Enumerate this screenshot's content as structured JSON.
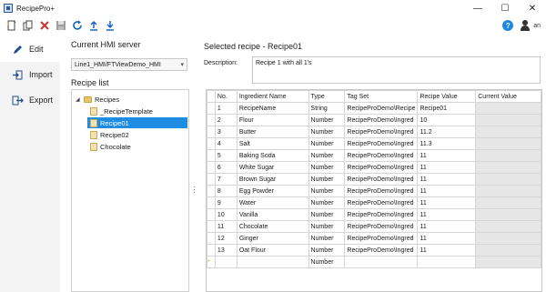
{
  "app": {
    "title": "RecipePro+"
  },
  "window_controls": {
    "minimize": "—",
    "maximize": "☐",
    "close": "✕"
  },
  "toolbar": {
    "buttons": [
      "new-icon",
      "duplicate-icon",
      "delete-icon",
      "save-icon",
      "refresh-icon",
      "upload-icon",
      "download-icon"
    ],
    "user_label": "an"
  },
  "nav": {
    "items": [
      {
        "label": "Edit",
        "icon": "pencil-icon"
      },
      {
        "label": "Import",
        "icon": "import-icon"
      },
      {
        "label": "Export",
        "icon": "export-icon"
      }
    ]
  },
  "server": {
    "title": "Current HMI server",
    "value": "Line1_HMI/FTViewDemo_HMI"
  },
  "recipe_list": {
    "title": "Recipe list",
    "root": "Recipes",
    "items": [
      "_RecipeTemplate",
      "Recipe01",
      "Recipe02",
      "Chocolate"
    ],
    "selected": "Recipe01"
  },
  "recipe": {
    "selected_title": "Selected recipe - Recipe01",
    "description_label": "Description:",
    "description": "Recipe 1 with all 1's"
  },
  "grid": {
    "columns": [
      "No.",
      "Ingredient Name",
      "Type",
      "Tag Set",
      "Recipe Value",
      "Current Value"
    ],
    "rows": [
      [
        "1",
        "RecipeName",
        "String",
        "RecipeProDemo\\Recipe",
        "Recipe01",
        ""
      ],
      [
        "2",
        "Flour",
        "Number",
        "RecipeProDemo\\Ingred",
        "10",
        ""
      ],
      [
        "3",
        "Butter",
        "Number",
        "RecipeProDemo\\Ingred",
        "11.2",
        ""
      ],
      [
        "4",
        "Salt",
        "Number",
        "RecipeProDemo\\Ingred",
        "11.3",
        ""
      ],
      [
        "5",
        "Baking Soda",
        "Number",
        "RecipeProDemo\\Ingred",
        "11",
        ""
      ],
      [
        "6",
        "White Sugar",
        "Number",
        "RecipeProDemo\\Ingred",
        "11",
        ""
      ],
      [
        "7",
        "Brown Sugar",
        "Number",
        "RecipeProDemo\\Ingred",
        "11",
        ""
      ],
      [
        "8",
        "Egg Powder",
        "Number",
        "RecipeProDemo\\Ingred",
        "11",
        ""
      ],
      [
        "9",
        "Water",
        "Number",
        "RecipeProDemo\\Ingred",
        "11",
        ""
      ],
      [
        "10",
        "Vanilla",
        "Number",
        "RecipeProDemo\\Ingred",
        "11",
        ""
      ],
      [
        "11",
        "Chocolate",
        "Number",
        "RecipeProDemo\\Ingred",
        "11",
        ""
      ],
      [
        "12",
        "Ginger",
        "Number",
        "RecipeProDemo\\Ingred",
        "11",
        ""
      ],
      [
        "13",
        "Oat Flour",
        "Number",
        "RecipeProDemo\\Ingred",
        "11",
        ""
      ]
    ],
    "new_row": {
      "marker": "*",
      "type": "Number"
    }
  }
}
